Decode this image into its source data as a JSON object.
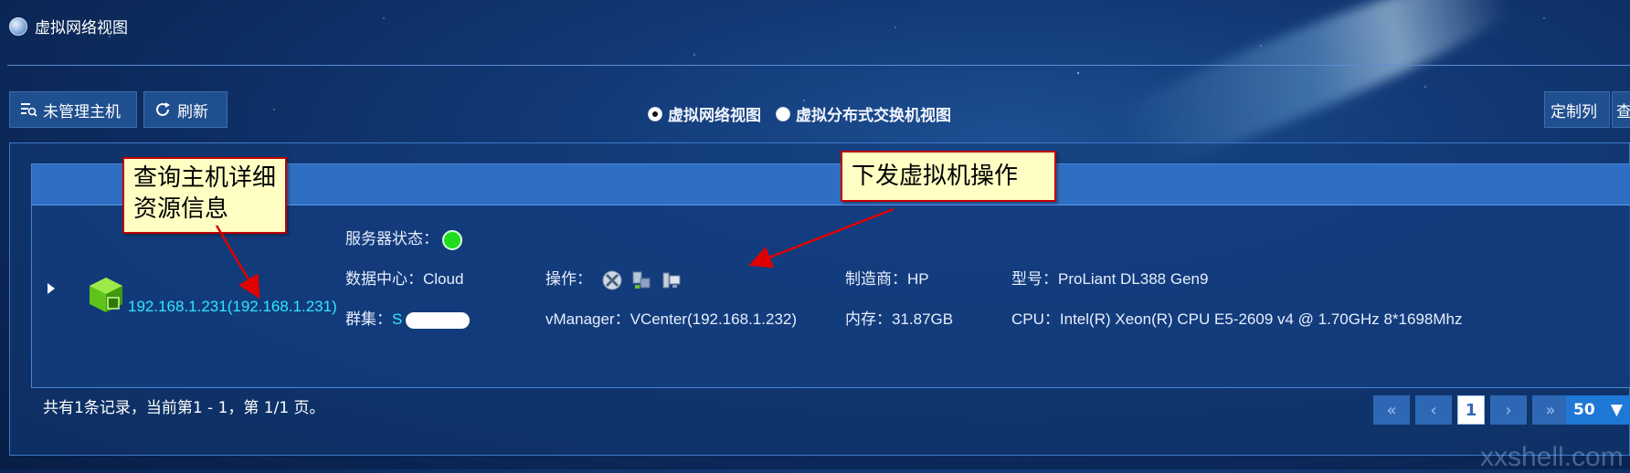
{
  "window": {
    "title": "虚拟网络视图"
  },
  "toolbar": {
    "unmanaged_hosts_label": "未管理主机",
    "refresh_label": "刷新",
    "custom_columns_label": "定制列",
    "query_label": "查"
  },
  "view_switch": {
    "options": [
      {
        "label": "虚拟网络视图",
        "selected": true
      },
      {
        "label": "虚拟分布式交换机视图",
        "selected": false
      }
    ]
  },
  "host": {
    "link_text": "192.168.1.231(192.168.1.231)",
    "status_label": "服务器状态：",
    "status_color": "#1fdc1f",
    "datacenter_label": "数据中心：",
    "datacenter_value": "Cloud",
    "cluster_label": "群集：",
    "cluster_value": "S",
    "operations_label": "操作：",
    "operation_icons": [
      "vm-console-icon",
      "vm-deploy-icon",
      "vm-monitor-icon"
    ],
    "vmanager_label": "vManager：",
    "vmanager_value": "VCenter(192.168.1.232)",
    "manufacturer_label": "制造商：",
    "manufacturer_value": "HP",
    "memory_label": "内存：",
    "memory_value": "31.87GB",
    "model_label": "型号：",
    "model_value": "ProLiant DL388 Gen9",
    "cpu_label": "CPU：",
    "cpu_value": "Intel(R) Xeon(R) CPU E5-2609 v4 @ 1.70GHz 8*1698Mhz"
  },
  "footer": {
    "records_text": "共有1条记录，当前第1 - 1，第 1/1 页。",
    "pager": {
      "first": "«",
      "prev": "‹",
      "current_page": "1",
      "next": "›",
      "last": "»"
    },
    "page_size": "50"
  },
  "callouts": {
    "host_details": "查询主机详细资源信息",
    "vm_operations": "下发虚拟机操作"
  },
  "watermark": "xxshell.com",
  "colors": {
    "accent_link": "#31e6ff",
    "header_bar": "#2f6fc3",
    "callout_bg": "#ffffc4",
    "callout_border": "#c00000"
  }
}
